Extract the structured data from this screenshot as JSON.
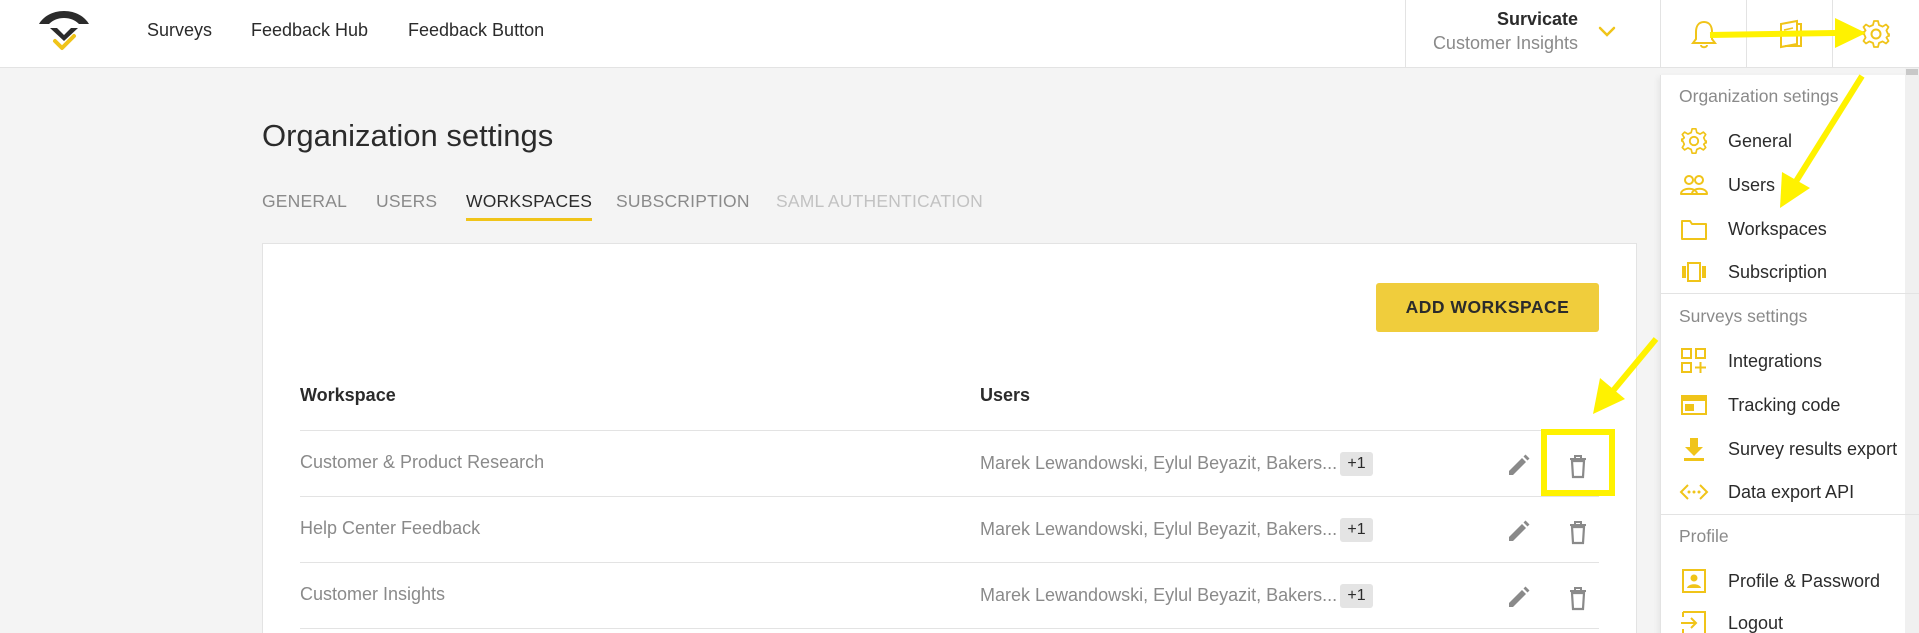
{
  "nav": {
    "items": [
      {
        "label": "Surveys"
      },
      {
        "label": "Feedback Hub"
      },
      {
        "label": "Feedback Button"
      }
    ]
  },
  "account": {
    "org": "Survicate",
    "workspace": "Customer Insights"
  },
  "page": {
    "title": "Organization settings",
    "tabs": [
      {
        "label": "GENERAL"
      },
      {
        "label": "USERS"
      },
      {
        "label": "WORKSPACES"
      },
      {
        "label": "SUBSCRIPTION"
      },
      {
        "label": "SAML AUTHENTICATION"
      }
    ],
    "add_button": "ADD WORKSPACE",
    "columns": {
      "workspace": "Workspace",
      "users": "Users"
    },
    "rows": [
      {
        "name": "Customer & Product Research",
        "users": "Marek Lewandowski, Eylul Beyazit, Bakers...",
        "extra": "+1"
      },
      {
        "name": "Help Center Feedback",
        "users": "Marek Lewandowski, Eylul Beyazit, Bakers...",
        "extra": "+1"
      },
      {
        "name": "Customer Insights",
        "users": "Marek Lewandowski, Eylul Beyazit, Bakers...",
        "extra": "+1"
      }
    ]
  },
  "dropdown": {
    "org_heading": "Organization setings",
    "org_items": [
      {
        "label": "General",
        "icon": "gear-icon"
      },
      {
        "label": "Users",
        "icon": "users-icon"
      },
      {
        "label": "Workspaces",
        "icon": "folder-icon"
      },
      {
        "label": "Subscription",
        "icon": "subscription-icon"
      }
    ],
    "surveys_heading": "Surveys settings",
    "surveys_items": [
      {
        "label": "Integrations",
        "icon": "integrations-icon"
      },
      {
        "label": "Tracking code",
        "icon": "tracking-code-icon"
      },
      {
        "label": "Survey results export",
        "icon": "download-icon"
      },
      {
        "label": "Data export API",
        "icon": "api-icon"
      }
    ],
    "profile_heading": "Profile",
    "profile_items": [
      {
        "label": "Profile & Password",
        "icon": "profile-icon"
      },
      {
        "label": "Logout",
        "icon": "logout-icon"
      }
    ]
  },
  "colors": {
    "accent": "#f0c419",
    "button": "#f0cd3c",
    "annotation": "#fff200",
    "muted_text": "#8a8a8a"
  }
}
